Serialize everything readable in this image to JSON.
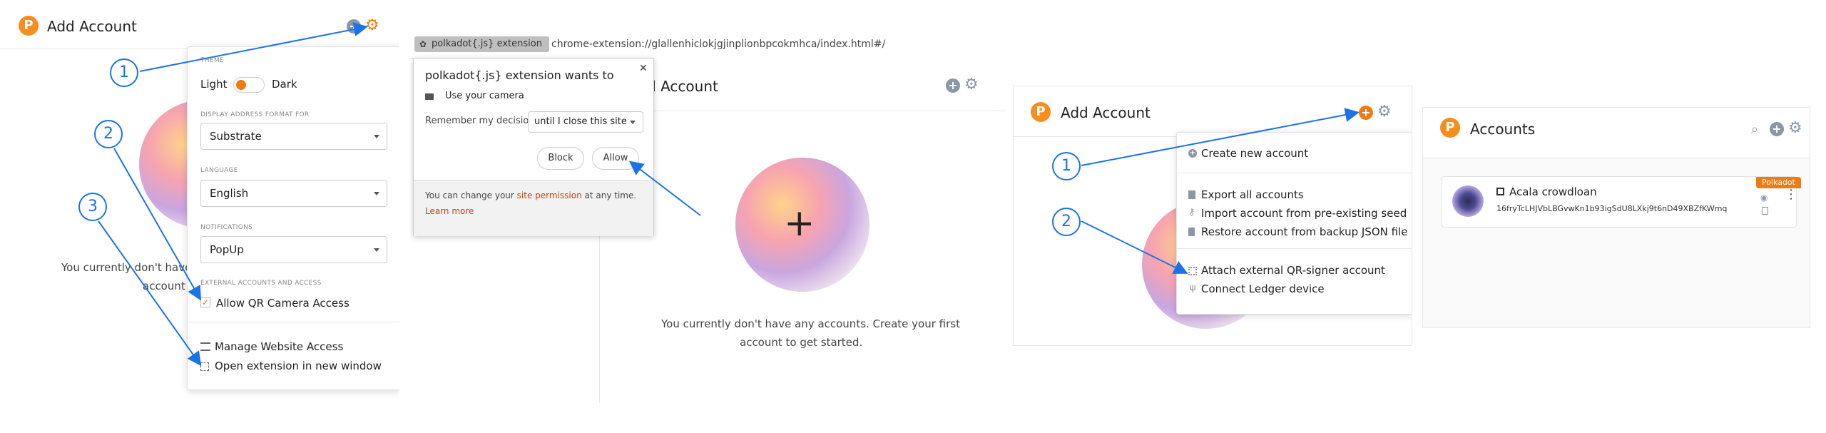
{
  "panel1": {
    "title": "Add Account",
    "logo_letter": "P",
    "callouts": [
      "1",
      "2",
      "3"
    ],
    "settings": {
      "theme_label": "THEME",
      "light": "Light",
      "dark": "Dark",
      "address_format_label": "DISPLAY ADDRESS FORMAT FOR",
      "address_format_value": "Substrate",
      "language_label": "LANGUAGE",
      "language_value": "English",
      "notifications_label": "NOTIFICATIONS",
      "notifications_value": "PopUp",
      "external_label": "EXTERNAL ACCOUNTS AND ACCESS",
      "qr_access": "Allow QR Camera Access",
      "manage_websites": "Manage Website Access",
      "open_window": "Open extension in new window"
    },
    "empty_text_1": "You currently don't have",
    "empty_text_2": "account t"
  },
  "panel2": {
    "ext_badge": "polkadot{.js} extension",
    "url": "chrome-extension://glallenhiclokjgjinplionbpcokmhca/index.html#/",
    "title": "Add Account",
    "permission": {
      "heading": "polkadot{.js} extension wants to",
      "camera": "Use your camera",
      "remember_label": "Remember my decision",
      "remember_value": "until I close this site",
      "block": "Block",
      "allow": "Allow",
      "footer_prefix": "You can change your ",
      "footer_link": "site permission",
      "footer_suffix": " at any time.",
      "learn_more": "Learn more"
    },
    "empty_line_1": "You currently don't have any accounts. Create your first",
    "empty_line_2": "account to get started."
  },
  "panel3": {
    "title": "Add Account",
    "callouts": [
      "1",
      "2"
    ],
    "menu": {
      "create": "Create new account",
      "export": "Export all accounts",
      "import_seed": "Import account from pre-existing seed",
      "restore_json": "Restore account from backup JSON file",
      "attach_qr": "Attach external QR-signer account",
      "connect_ledger": "Connect Ledger device"
    }
  },
  "panel4": {
    "title": "Accounts",
    "account_name": "Acala crowdloan",
    "account_address": "16fryTcLHJVbLBGvwKn1b93igSdU8LXkj9t6nD49XBZfKWmq",
    "network_badge": "Polkadot"
  },
  "colors": {
    "accent_orange": "#f07b13",
    "callout_blue": "#1a73e8",
    "muted_icon": "#8b97a6"
  }
}
